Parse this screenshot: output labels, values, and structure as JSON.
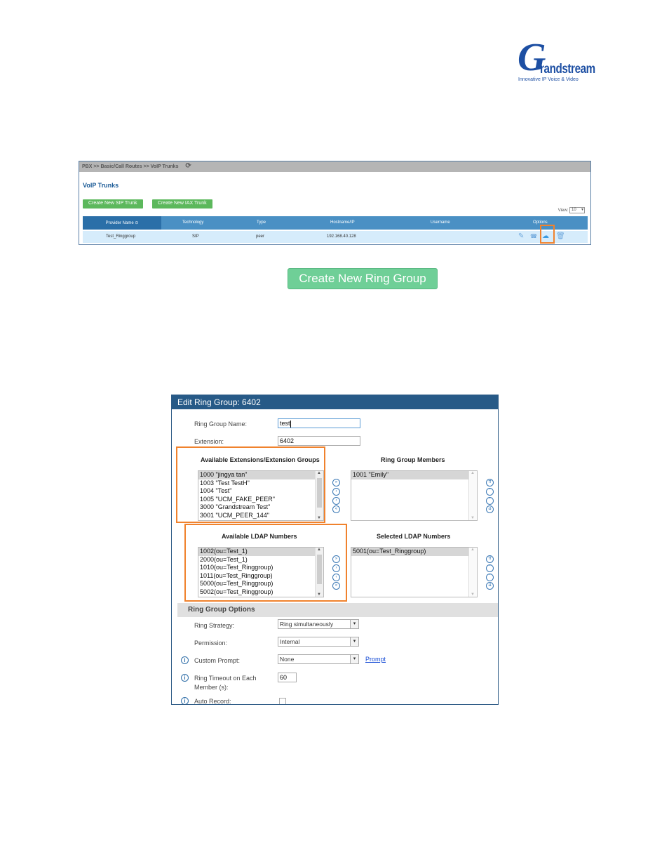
{
  "logo": {
    "script": "G",
    "word": "randstream",
    "tagline": "Innovative IP Voice & Video"
  },
  "voip": {
    "breadcrumb": "PBX >> Basic/Call Routes >> VoIP Trunks",
    "title": "VoIP Trunks",
    "btn_sip": "Create New SIP Trunk",
    "btn_iax": "Create New IAX Trunk",
    "view_label": "View:",
    "view_value": "10",
    "columns": [
      "Provider Name",
      "Technology",
      "Type",
      "Hostname/IP",
      "Username",
      "Options"
    ],
    "row": {
      "provider": "Test_Ringgroup",
      "technology": "SIP",
      "type": "peer",
      "host": "192.168.40.128",
      "username": ""
    },
    "icons": [
      "edit-icon",
      "dod-icon",
      "cloud-upload-icon",
      "delete-icon"
    ]
  },
  "create_ring_group_button": "Create New Ring Group",
  "dialog": {
    "title": "Edit Ring Group: 6402",
    "name_label": "Ring Group Name:",
    "name_value": "test",
    "ext_label": "Extension:",
    "ext_value": "6402",
    "avail_ext_title": "Available Extensions/Extension Groups",
    "avail_ext": [
      "1000 \"jingya tan\"",
      "1003 \"Test TestH\"",
      "1004 \"Test\"",
      "1005 \"UCM_FAKE_PEER\"",
      "3000 \"Grandstream Test\"",
      "3001 \"UCM_PEER_144\""
    ],
    "members_title": "Ring Group Members",
    "members": [
      "1001 \"Emily\""
    ],
    "avail_ldap_title": "Available LDAP Numbers",
    "avail_ldap": [
      "1002(ou=Test_1)",
      "2000(ou=Test_1)",
      "1010(ou=Test_Ringgroup)",
      "1011(ou=Test_Ringgroup)",
      "5000(ou=Test_Ringgroup)",
      "5002(ou=Test_Ringgroup)"
    ],
    "selected_ldap_title": "Selected LDAP Numbers",
    "selected_ldap": [
      "5001(ou=Test_Ringgroup)"
    ],
    "options_title": "Ring Group Options",
    "strategy_label": "Ring Strategy:",
    "strategy_value": "Ring simultaneously",
    "permission_label": "Permission:",
    "permission_value": "Internal",
    "prompt_label": "Custom Prompt:",
    "prompt_value": "None",
    "prompt_link": "Prompt",
    "timeout_label": "Ring Timeout on Each",
    "timeout_label2": "Member (s):",
    "timeout_value": "60",
    "autorecord_label": "Auto Record:"
  }
}
